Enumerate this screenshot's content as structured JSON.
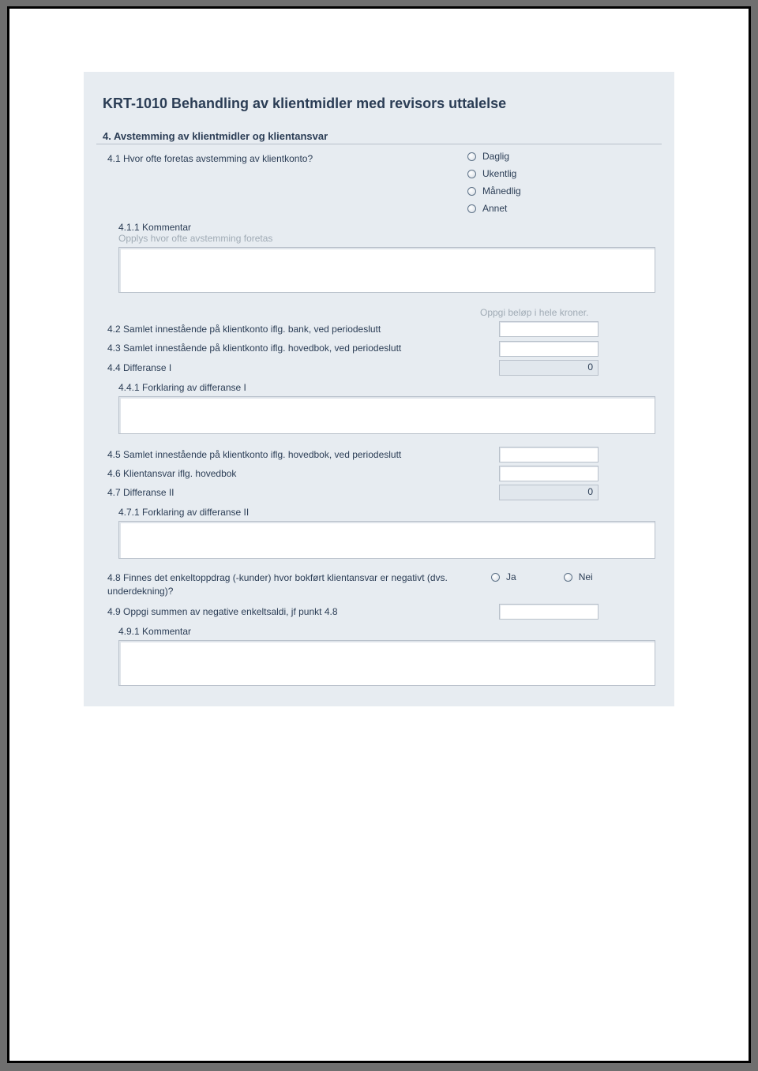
{
  "title": "KRT-1010 Behandling av klientmidler med revisors uttalelse",
  "section4": {
    "heading": "4. Avstemming av klientmidler og klientansvar",
    "q41": {
      "label": "4.1 Hvor ofte foretas avstemming av klientkonto?",
      "options": [
        "Daglig",
        "Ukentlig",
        "Månedlig",
        "Annet"
      ]
    },
    "q411": {
      "label": "4.1.1 Kommentar",
      "hint": "Opplys hvor ofte avstemming foretas"
    },
    "amount_hint": "Oppgi beløp i hele kroner.",
    "q42": {
      "label": "4.2 Samlet innestående på klientkonto iflg. bank, ved periodeslutt"
    },
    "q43": {
      "label": "4.3 Samlet innestående på klientkonto iflg. hovedbok, ved periodeslutt"
    },
    "q44": {
      "label": "4.4 Differanse I",
      "value": "0"
    },
    "q441": {
      "label": "4.4.1 Forklaring av differanse I"
    },
    "q45": {
      "label": "4.5 Samlet innestående på klientkonto iflg. hovedbok, ved periodeslutt"
    },
    "q46": {
      "label": "4.6 Klientansvar iflg. hovedbok"
    },
    "q47": {
      "label": "4.7 Differanse II",
      "value": "0"
    },
    "q471": {
      "label": "4.7.1 Forklaring av differanse II"
    },
    "q48": {
      "label": "4.8 Finnes det enkeltoppdrag (-kunder) hvor bokført klientansvar er negativt (dvs. underdekning)?",
      "options": [
        "Ja",
        "Nei"
      ]
    },
    "q49": {
      "label": "4.9 Oppgi summen av negative enkeltsaldi, jf punkt 4.8"
    },
    "q491": {
      "label": "4.9.1 Kommentar"
    }
  }
}
